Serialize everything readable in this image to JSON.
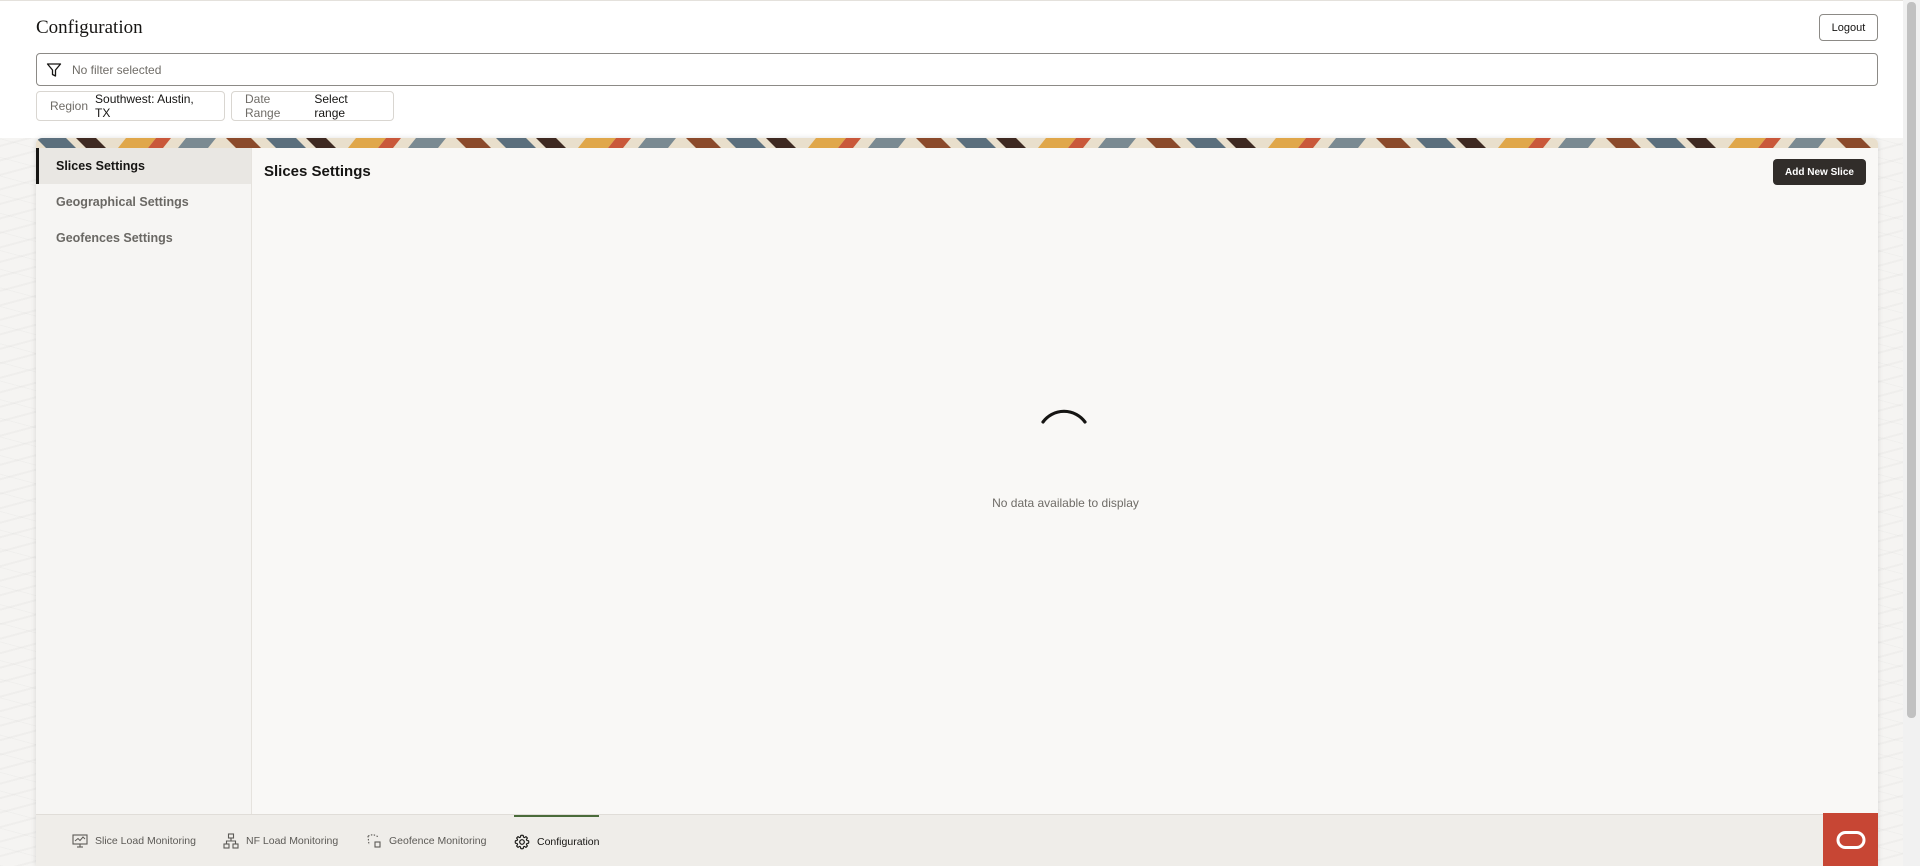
{
  "page": {
    "title": "Configuration"
  },
  "header": {
    "logout_label": "Logout"
  },
  "filter": {
    "placeholder": "No filter selected"
  },
  "chips": {
    "region": {
      "label": "Region",
      "value": "Southwest: Austin, TX"
    },
    "date_range": {
      "label": "Date Range",
      "value": "Select range"
    }
  },
  "sidebar": {
    "items": [
      {
        "label": "Slices Settings",
        "active": true
      },
      {
        "label": "Geographical Settings",
        "active": false
      },
      {
        "label": "Geofences Settings",
        "active": false
      }
    ]
  },
  "content": {
    "title": "Slices Settings",
    "add_button_label": "Add New Slice",
    "empty_message": "No data available to display"
  },
  "bottom_nav": {
    "tabs": [
      {
        "label": "Slice Load Monitoring",
        "icon": "monitor-chart-icon"
      },
      {
        "label": "NF Load Monitoring",
        "icon": "network-nodes-icon"
      },
      {
        "label": "Geofence Monitoring",
        "icon": "geofence-icon"
      },
      {
        "label": "Configuration",
        "icon": "gear-icon",
        "active": true
      }
    ]
  },
  "colors": {
    "primary_button": "#312d2a",
    "brand_logo": "#c74634",
    "active_tab_indicator": "#4a6b3a"
  }
}
